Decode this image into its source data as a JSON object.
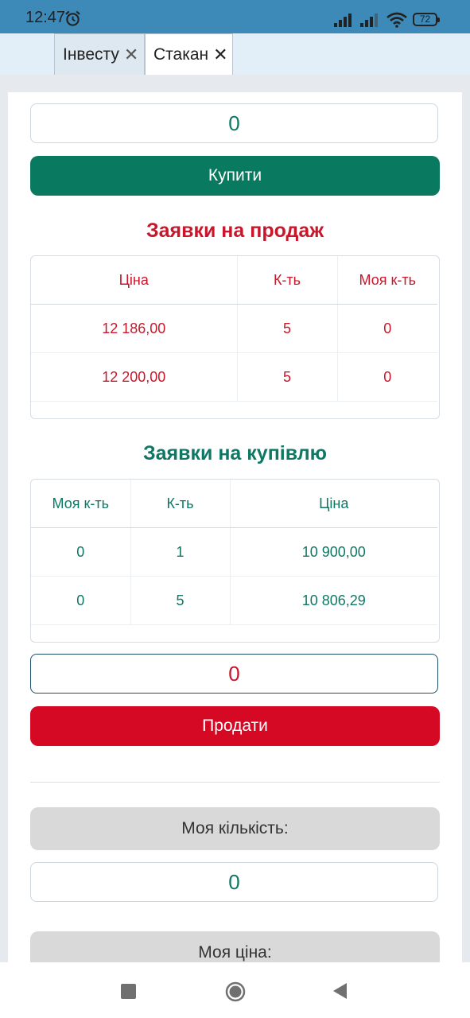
{
  "status_bar": {
    "time": "12:47",
    "battery": "72"
  },
  "tabs": [
    {
      "label": "Інвесту",
      "close": "✕"
    },
    {
      "label": "Стакан",
      "close": "✕"
    }
  ],
  "buy_amount": "0",
  "buy_button": "Купити",
  "sell_orders": {
    "title": "Заявки на продаж",
    "headers": [
      "Ціна",
      "К-ть",
      "Моя к-ть"
    ],
    "rows": [
      [
        "12 186,00",
        "5",
        "0"
      ],
      [
        "12 200,00",
        "5",
        "0"
      ]
    ]
  },
  "buy_orders": {
    "title": "Заявки на купівлю",
    "headers": [
      "Моя к-ть",
      "К-ть",
      "Ціна"
    ],
    "rows": [
      [
        "0",
        "1",
        "10 900,00"
      ],
      [
        "0",
        "5",
        "10 806,29"
      ]
    ]
  },
  "sell_amount": "0",
  "sell_button": "Продати",
  "my_quantity_label": "Моя кількість:",
  "my_quantity_value": "0",
  "my_price_label": "Моя ціна:",
  "colors": {
    "buy_green": "#09795f",
    "sell_red": "#d60924",
    "status_bar": "#3d8ab9"
  },
  "icons": {
    "alarm": "alarm-clock-icon",
    "signal": "cell-signal-icon",
    "wifi": "wifi-icon",
    "battery": "battery-icon",
    "close": "close-icon",
    "nav_recent": "square-icon",
    "nav_home": "circle-icon",
    "nav_back": "back-triangle-icon"
  }
}
